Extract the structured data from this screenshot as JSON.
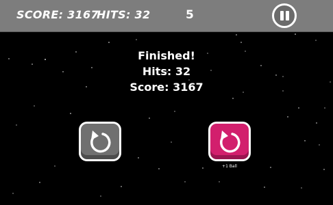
{
  "hud": {
    "score": "SCORE: 3167",
    "hits": "HITS: 32",
    "level": "5",
    "pause_icon": "pause-icon"
  },
  "results": {
    "title": "Finished!",
    "hits": "Hits: 32",
    "score": "Score: 3167"
  },
  "buttons": {
    "restart_icon": "restart-icon",
    "restart_bonus_icon": "restart-icon",
    "bonus_label": "+1 Ball"
  },
  "colors": {
    "topbar": "#7d7d7d",
    "background": "#000000",
    "gray_button": "#707070",
    "pink_button": "#d21f6d"
  }
}
